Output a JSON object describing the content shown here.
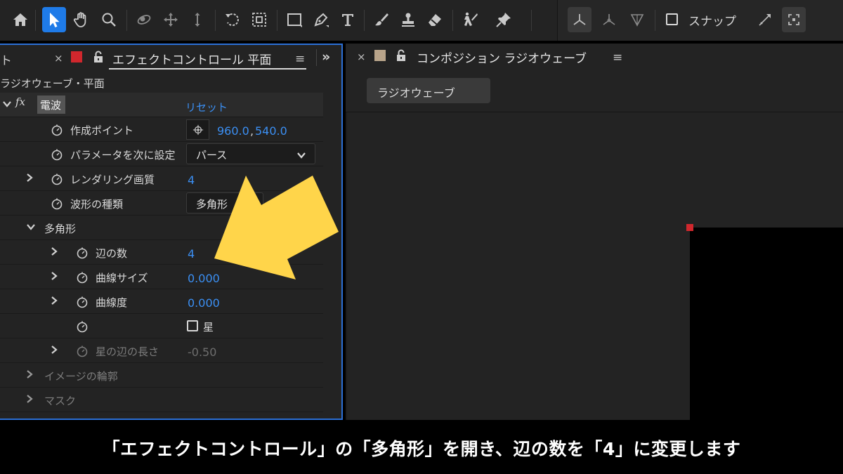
{
  "toolbar": {
    "tools": [
      {
        "icon": "home-icon"
      },
      {
        "icon": "selection-arrow-icon",
        "active": true
      },
      {
        "icon": "hand-icon"
      },
      {
        "icon": "zoom-icon"
      },
      {
        "icon": "orbit-camera-icon"
      },
      {
        "icon": "pan-camera-icon"
      },
      {
        "icon": "dolly-camera-icon"
      },
      {
        "icon": "rotate-icon"
      },
      {
        "icon": "pan-behind-icon"
      },
      {
        "icon": "rectangle-icon"
      },
      {
        "icon": "pen-icon"
      },
      {
        "icon": "type-icon"
      },
      {
        "icon": "brush-icon"
      },
      {
        "icon": "clone-stamp-icon"
      },
      {
        "icon": "eraser-icon"
      },
      {
        "icon": "roto-brush-icon"
      },
      {
        "icon": "puppet-pin-icon"
      }
    ],
    "axis_modes": [
      "local-axis-icon",
      "world-axis-icon",
      "view-axis-icon"
    ],
    "snap_label": "スナップ",
    "snap_checked": false
  },
  "effect_panel": {
    "prev_tab_fragment": "ト",
    "close": "×",
    "tab_title": "エフェクトコントロール 平面",
    "menu": "≡",
    "overflow": "»",
    "label_color": "#d0272d",
    "layer_header": "ラジオウェーブ・平面",
    "effect": {
      "fx": "fx",
      "name": "電波",
      "reset": "リセット"
    },
    "properties": {
      "anchor": {
        "label": "作成ポイント",
        "value_x": "960.0",
        "value_sep": ",",
        "value_y": "540.0"
      },
      "param": {
        "label": "パラメータを次に設定",
        "value": "パース"
      },
      "quality": {
        "label": "レンダリング画質",
        "value": "4"
      },
      "wave_type": {
        "label": "波形の種類",
        "value": "多角形"
      },
      "polygon_group": {
        "label": "多角形"
      },
      "sides": {
        "label": "辺の数",
        "value": "4"
      },
      "curve_size": {
        "label": "曲線サイズ",
        "value": "0.000"
      },
      "curviness": {
        "label": "曲線度",
        "value": "0.000"
      },
      "star": {
        "label": "星",
        "checked": false
      },
      "star_depth": {
        "label": "星の辺の長さ",
        "value": "-0.50"
      },
      "image_contour": {
        "label": "イメージの輪郭"
      },
      "mask": {
        "label": "マスク"
      }
    }
  },
  "comp_panel": {
    "close": "×",
    "tab_title": "コンポジション ラジオウェーブ",
    "menu": "≡",
    "label_color": "#b8a48a",
    "comp_button": "ラジオウェーブ"
  },
  "caption": {
    "text": "「エフェクトコントロール」の「多角形」を開き、辺の数を「4」に変更します"
  },
  "colors": {
    "accent_blue": "#3b8ff3",
    "active_tool": "#1f7be8",
    "highlight_arrow": "#ffd54a",
    "panel_focus_border": "#2b6fd6"
  }
}
